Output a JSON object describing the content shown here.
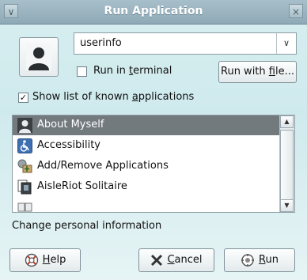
{
  "window": {
    "title": "Run Application"
  },
  "titlebar": {
    "menu_glyph": "∨",
    "close_glyph": "×"
  },
  "command": {
    "value": "userinfo",
    "dropdown_glyph": "∨"
  },
  "run_in_terminal": {
    "label_pre": "Run in ",
    "label_mnemonic": "t",
    "label_post": "erminal",
    "checked": false
  },
  "run_with_file": {
    "label_pre": "Run with ",
    "label_mnemonic": "f",
    "label_post": "ile..."
  },
  "show_list": {
    "label_pre": "Show list of known ",
    "label_mnemonic": "a",
    "label_post": "pplications",
    "checked": true,
    "check_glyph": "✓"
  },
  "applications": [
    {
      "name": "About Myself",
      "icon": "person-icon",
      "selected": true
    },
    {
      "name": "Accessibility",
      "icon": "accessibility-icon",
      "selected": false
    },
    {
      "name": "Add/Remove Applications",
      "icon": "package-icon",
      "selected": false
    },
    {
      "name": "AisleRiot Solitaire",
      "icon": "cards-icon",
      "selected": false
    }
  ],
  "scrollbar": {
    "up_glyph": "▲",
    "down_glyph": "▼"
  },
  "status": "Change personal information",
  "buttons": {
    "help": {
      "mnemonic": "H",
      "rest": "elp"
    },
    "cancel": {
      "mnemonic": "C",
      "rest": "ancel"
    },
    "run": {
      "mnemonic": "R",
      "rest": "un"
    }
  }
}
